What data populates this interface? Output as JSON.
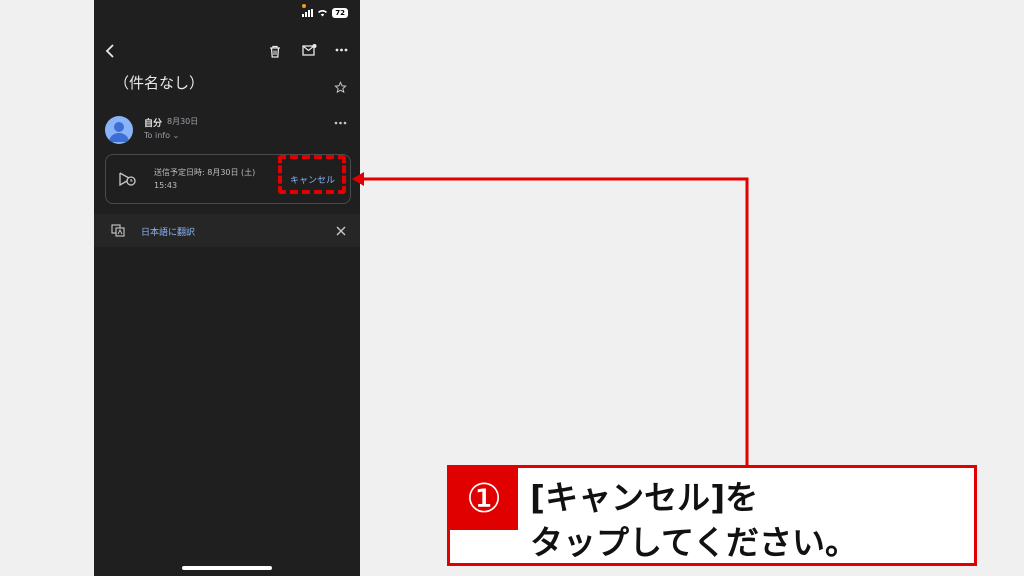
{
  "status_bar": {
    "battery": "72"
  },
  "email": {
    "subject": "（件名なし）",
    "sender": "自分",
    "date": "8月30日",
    "to": "To info ⌄"
  },
  "scheduled": {
    "line1": "送信予定日時: 8月30日 (土)",
    "line2": "15:43",
    "cancel_label": "キャンセル"
  },
  "translate_bar": {
    "label": "日本語に翻訳"
  },
  "callout": {
    "number": "①",
    "line1": "[キャンセル]を",
    "line2": "タップしてください。"
  },
  "colors": {
    "accent": "#8ab4f8",
    "highlight": "#e00000",
    "background": "#1f1f1f"
  }
}
